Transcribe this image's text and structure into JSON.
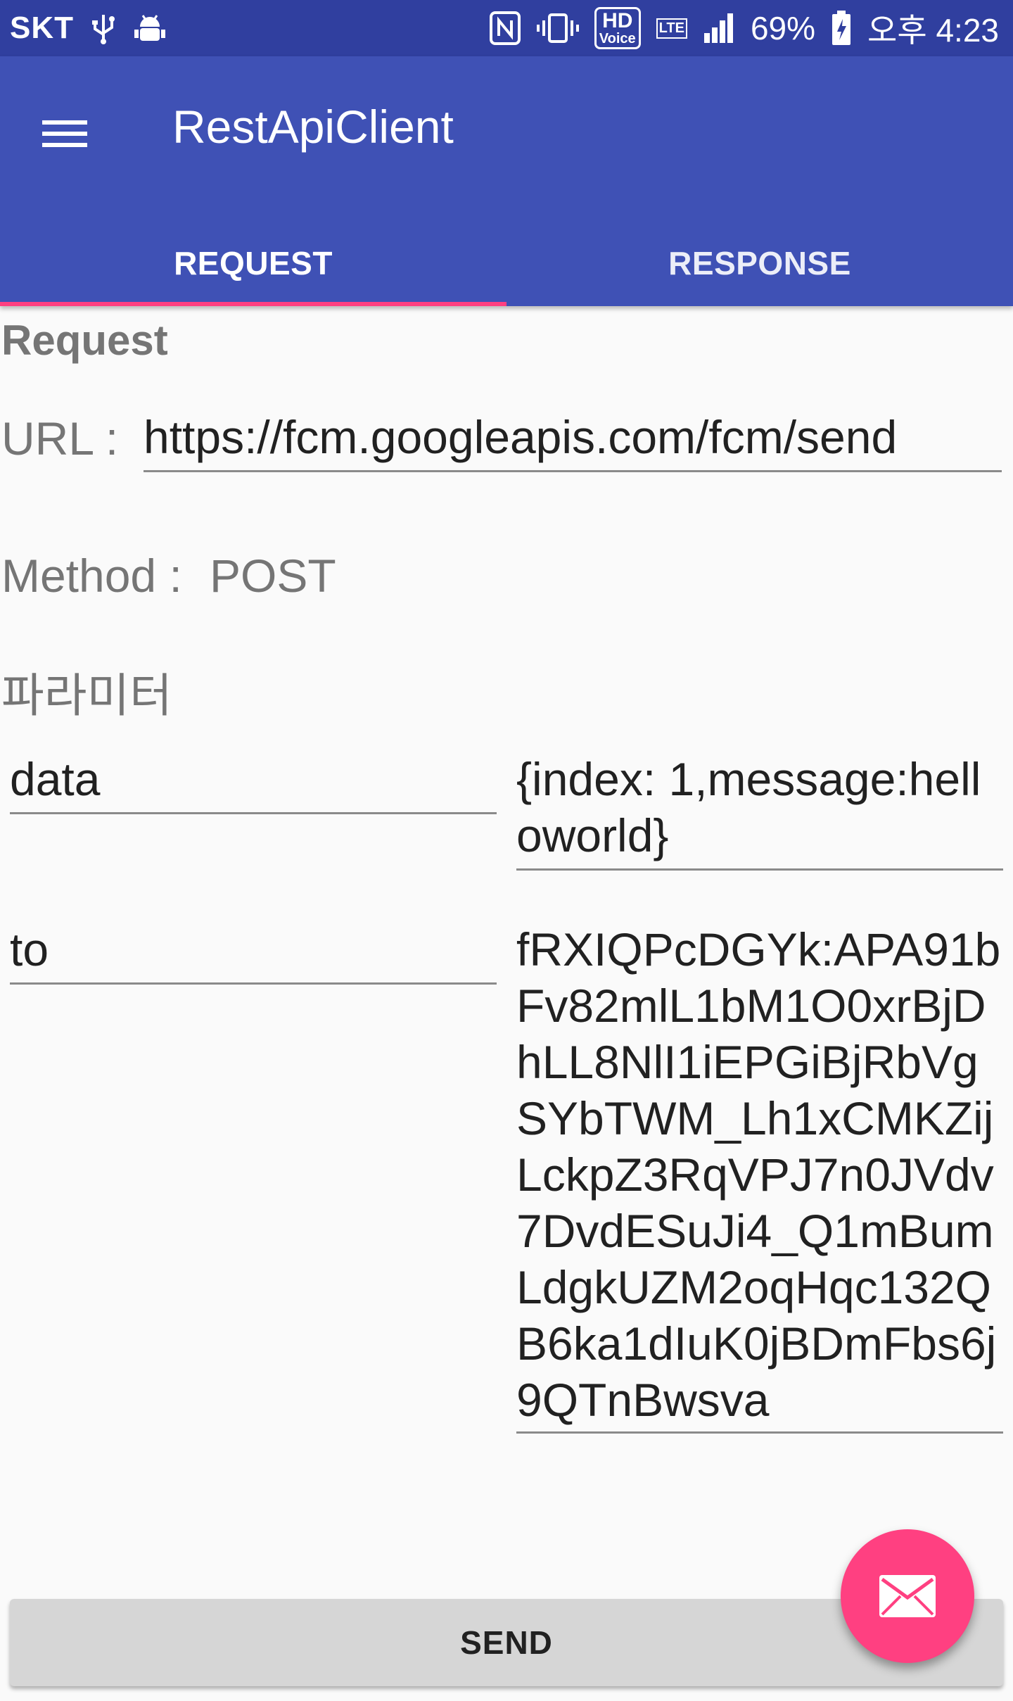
{
  "status_bar": {
    "carrier": "SKT",
    "hd_label": "HD",
    "voice_label": "Voice",
    "lte_label": "LTE",
    "battery": "69%",
    "time": "오후 4:23"
  },
  "app_bar": {
    "title": "RestApiClient"
  },
  "tabs": [
    {
      "label": "REQUEST",
      "selected": true
    },
    {
      "label": "RESPONSE",
      "selected": false
    }
  ],
  "request": {
    "section_title": "Request",
    "url_label": "URL :",
    "url_value": "https://fcm.googleapis.com/fcm/send",
    "method_label": "Method :",
    "method_value": "POST",
    "params_label": "파라미터",
    "params": [
      {
        "key": "data",
        "value": "{index: 1,message:helloworld}"
      },
      {
        "key": "to",
        "value": "fRXIQPcDGYk:APA91bFv82mlL1bM1O0xrBjDhLL8NlI1iEPGiBjRbVgSYbTWM_Lh1xCMKZijLckpZ3RqVPJ7n0JVdv7DvdESuJi4_Q1mBumLdgkUZM2oqHqc132QB6ka1dIuK0jBDmFbs6j9QTnBwsva"
      }
    ]
  },
  "send_button": {
    "label": "SEND"
  },
  "colors": {
    "primary": "#3f51b5",
    "primary_dark": "#303f9f",
    "accent": "#ff4081"
  },
  "icons": {
    "menu": "hamburger-menu-icon",
    "fab": "mail-icon"
  }
}
